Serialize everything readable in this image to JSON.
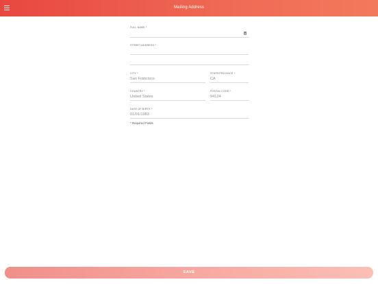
{
  "header": {
    "title": "Mailing Address",
    "menu_icon": "hamburger-menu-icon"
  },
  "form": {
    "full_name": {
      "label": "FULL NAME *",
      "value": "",
      "icon": "contact-book-icon"
    },
    "street_address": {
      "label": "STREET ADDRESS *",
      "value": ""
    },
    "city": {
      "label": "CITY *",
      "value": "San Francisco"
    },
    "state": {
      "label": "STATE/PROVINCE *",
      "value": "CA"
    },
    "country": {
      "label": "COUNTRY *",
      "value": "United States"
    },
    "postal_code": {
      "label": "POSTAL CODE *",
      "value": "94124"
    },
    "date_of_birth": {
      "label": "DATE OF BIRTH *",
      "value": "01/01/1983"
    },
    "required_note": "* Required Fields"
  },
  "footer": {
    "save_label": "SAVE"
  },
  "colors": {
    "header_start": "#e8473f",
    "header_end": "#f3795c",
    "save_start": "#f08f8a",
    "save_end": "#fbbfb6"
  }
}
